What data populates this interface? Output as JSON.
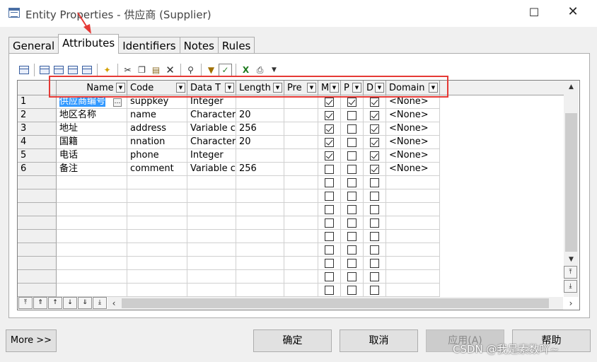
{
  "window": {
    "title": "Entity Properties - 供应商 (Supplier)"
  },
  "tabs": [
    {
      "label": "General",
      "active": false
    },
    {
      "label": "Attributes",
      "active": true
    },
    {
      "label": "Identifiers",
      "active": false
    },
    {
      "label": "Notes",
      "active": false
    },
    {
      "label": "Rules",
      "active": false
    }
  ],
  "toolbar_icons": [
    "properties-icon",
    "insert-row-icon",
    "add-row-icon",
    "add-attributes-icon",
    "reuse-attributes-icon",
    "new-icon",
    "cut-icon",
    "copy-icon",
    "paste-icon",
    "delete-icon",
    "find-icon",
    "filter-icon",
    "filter-active-icon",
    "excel-export-icon",
    "print-icon",
    "dropdown-icon"
  ],
  "grid": {
    "columns": [
      "Name",
      "Code",
      "Data T",
      "Length",
      "Pre",
      "M",
      "P",
      "D",
      "Domain"
    ],
    "rows": [
      {
        "n": "1",
        "name": "供应商编号",
        "code": "suppkey",
        "type": "Integer",
        "length": "",
        "m": true,
        "p": true,
        "d": true,
        "domain": "<None>"
      },
      {
        "n": "2",
        "name": "地区名称",
        "code": "name",
        "type": "Character",
        "length": "20",
        "m": true,
        "p": false,
        "d": true,
        "domain": "<None>"
      },
      {
        "n": "3",
        "name": "地址",
        "code": "address",
        "type": "Variable c",
        "length": "256",
        "m": true,
        "p": false,
        "d": true,
        "domain": "<None>"
      },
      {
        "n": "4",
        "name": "国籍",
        "code": "nnation",
        "type": "Character",
        "length": "20",
        "m": true,
        "p": false,
        "d": true,
        "domain": "<None>"
      },
      {
        "n": "5",
        "name": "电话",
        "code": "phone",
        "type": "Integer",
        "length": "",
        "m": true,
        "p": false,
        "d": true,
        "domain": "<None>"
      },
      {
        "n": "6",
        "name": "备注",
        "code": "comment",
        "type": "Variable c",
        "length": "256",
        "m": false,
        "p": false,
        "d": true,
        "domain": "<None>"
      }
    ],
    "empty_rows": 9
  },
  "buttons": {
    "more": "More >>",
    "ok": "确定",
    "cancel": "取消",
    "apply": "应用(A)",
    "help": "帮助"
  },
  "watermark": "CSDN @我是素数吖~"
}
